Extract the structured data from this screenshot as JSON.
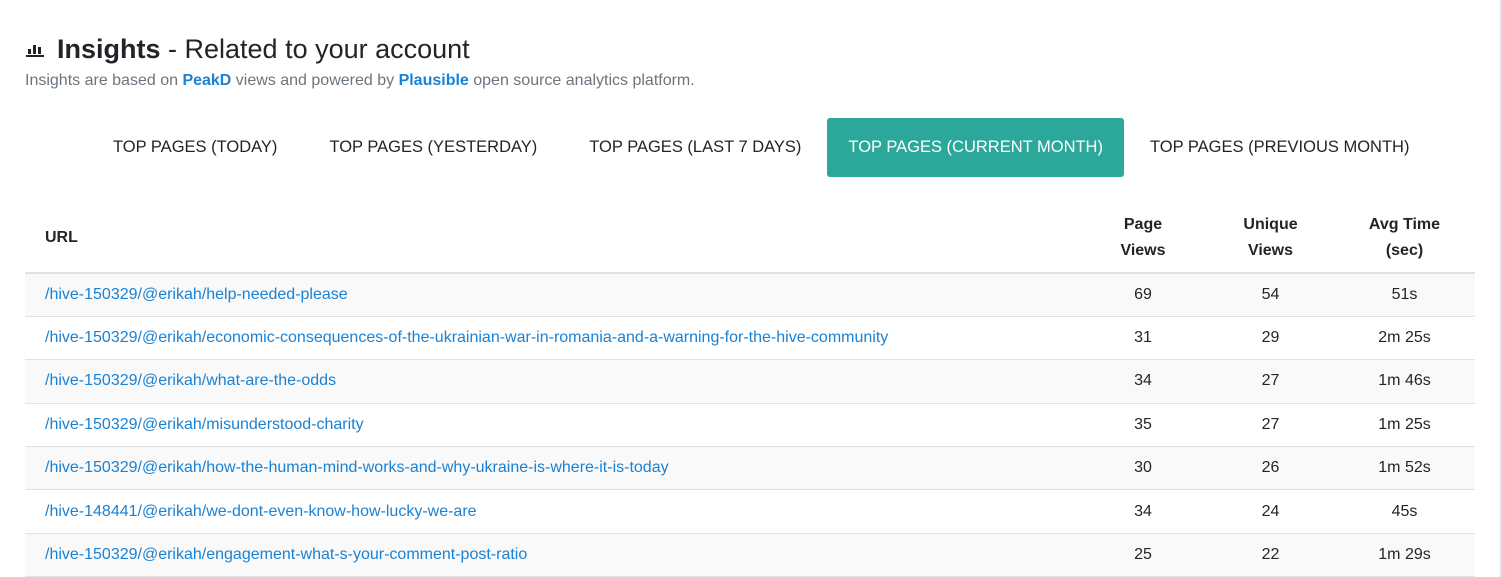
{
  "header": {
    "title_bold": "Insights",
    "title_rest": " - Related to your account",
    "icon": "bar-chart-icon"
  },
  "subtitle": {
    "pre": "Insights are based on ",
    "link1": "PeakD",
    "mid": " views and powered by ",
    "link2": "Plausible",
    "post": " open source analytics platform."
  },
  "tabs": [
    {
      "label": "TOP PAGES (TODAY)",
      "active": false
    },
    {
      "label": "TOP PAGES (YESTERDAY)",
      "active": false
    },
    {
      "label": "TOP PAGES (LAST 7 DAYS)",
      "active": false
    },
    {
      "label": "TOP PAGES (CURRENT MONTH)",
      "active": true
    },
    {
      "label": "TOP PAGES (PREVIOUS MONTH)",
      "active": false
    }
  ],
  "colors": {
    "accent": "#2ba89a",
    "link": "#1a82d4"
  },
  "table": {
    "headers": {
      "url": "URL",
      "page_views_1": "Page",
      "page_views_2": "Views",
      "unique_views_1": "Unique",
      "unique_views_2": "Views",
      "avg_time_1": "Avg Time",
      "avg_time_2": "(sec)"
    },
    "rows": [
      {
        "url": "/hive-150329/@erikah/help-needed-please",
        "page_views": "69",
        "unique_views": "54",
        "avg_time": "51s"
      },
      {
        "url": "/hive-150329/@erikah/economic-consequences-of-the-ukrainian-war-in-romania-and-a-warning-for-the-hive-community",
        "page_views": "31",
        "unique_views": "29",
        "avg_time": "2m 25s"
      },
      {
        "url": "/hive-150329/@erikah/what-are-the-odds",
        "page_views": "34",
        "unique_views": "27",
        "avg_time": "1m 46s"
      },
      {
        "url": "/hive-150329/@erikah/misunderstood-charity",
        "page_views": "35",
        "unique_views": "27",
        "avg_time": "1m 25s"
      },
      {
        "url": "/hive-150329/@erikah/how-the-human-mind-works-and-why-ukraine-is-where-it-is-today",
        "page_views": "30",
        "unique_views": "26",
        "avg_time": "1m 52s"
      },
      {
        "url": "/hive-148441/@erikah/we-dont-even-know-how-lucky-we-are",
        "page_views": "34",
        "unique_views": "24",
        "avg_time": "45s"
      },
      {
        "url": "/hive-150329/@erikah/engagement-what-s-your-comment-post-ratio",
        "page_views": "25",
        "unique_views": "22",
        "avg_time": "1m 29s"
      }
    ]
  }
}
